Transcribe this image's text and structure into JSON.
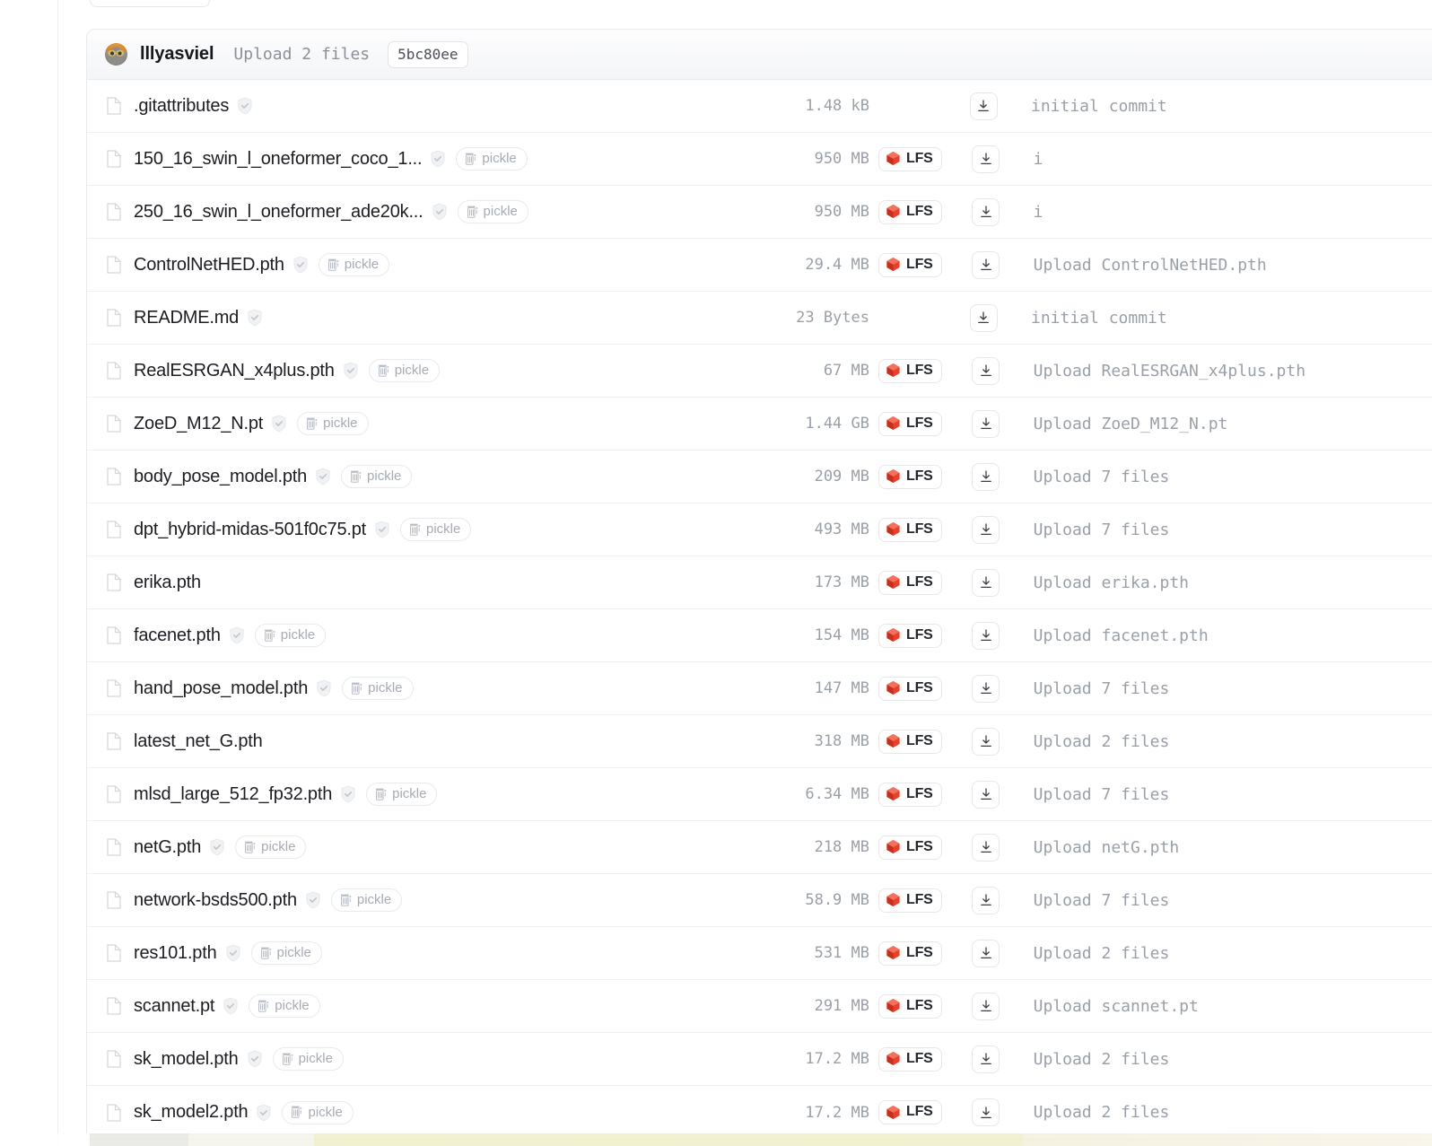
{
  "commit_header": {
    "author": "lllyasviel",
    "message": "Upload 2 files",
    "sha": "5bc80ee",
    "avatar_icon": "cat-avatar"
  },
  "badges": {
    "pickle_label": "pickle",
    "lfs_label": "LFS",
    "shield_icon": "shield-check-icon",
    "download_icon": "download-icon",
    "file_icon": "file-document-icon",
    "pickle_icon": "pickle-jar-icon",
    "lfs_icon": "lfs-cube-icon"
  },
  "colors": {
    "lfs_red": "#e8402a",
    "header_bg": "#f4f5f7",
    "border": "#e9eaec",
    "muted_text": "#9aa0a8",
    "name_text": "#1b1d22"
  },
  "files": [
    {
      "name": ".gitattributes",
      "shield": true,
      "pickle": false,
      "size": "1.48 kB",
      "lfs": false,
      "commit": "initial commit"
    },
    {
      "name": "150_16_swin_l_oneformer_coco_1...",
      "shield": true,
      "pickle": true,
      "size": "950 MB",
      "lfs": true,
      "commit": "i"
    },
    {
      "name": "250_16_swin_l_oneformer_ade20k...",
      "shield": true,
      "pickle": true,
      "size": "950 MB",
      "lfs": true,
      "commit": "i"
    },
    {
      "name": "ControlNetHED.pth",
      "shield": true,
      "pickle": true,
      "size": "29.4 MB",
      "lfs": true,
      "commit": "Upload ControlNetHED.pth"
    },
    {
      "name": "README.md",
      "shield": true,
      "pickle": false,
      "size": "23 Bytes",
      "lfs": false,
      "commit": "initial commit"
    },
    {
      "name": "RealESRGAN_x4plus.pth",
      "shield": true,
      "pickle": true,
      "size": "67 MB",
      "lfs": true,
      "commit": "Upload RealESRGAN_x4plus.pth"
    },
    {
      "name": "ZoeD_M12_N.pt",
      "shield": true,
      "pickle": true,
      "size": "1.44 GB",
      "lfs": true,
      "commit": "Upload ZoeD_M12_N.pt"
    },
    {
      "name": "body_pose_model.pth",
      "shield": true,
      "pickle": true,
      "size": "209 MB",
      "lfs": true,
      "commit": "Upload 7 files"
    },
    {
      "name": "dpt_hybrid-midas-501f0c75.pt",
      "shield": true,
      "pickle": true,
      "size": "493 MB",
      "lfs": true,
      "commit": "Upload 7 files"
    },
    {
      "name": "erika.pth",
      "shield": false,
      "pickle": false,
      "size": "173 MB",
      "lfs": true,
      "commit": "Upload erika.pth"
    },
    {
      "name": "facenet.pth",
      "shield": true,
      "pickle": true,
      "size": "154 MB",
      "lfs": true,
      "commit": "Upload facenet.pth"
    },
    {
      "name": "hand_pose_model.pth",
      "shield": true,
      "pickle": true,
      "size": "147 MB",
      "lfs": true,
      "commit": "Upload 7 files"
    },
    {
      "name": "latest_net_G.pth",
      "shield": false,
      "pickle": false,
      "size": "318 MB",
      "lfs": true,
      "commit": "Upload 2 files"
    },
    {
      "name": "mlsd_large_512_fp32.pth",
      "shield": true,
      "pickle": true,
      "size": "6.34 MB",
      "lfs": true,
      "commit": "Upload 7 files"
    },
    {
      "name": "netG.pth",
      "shield": true,
      "pickle": true,
      "size": "218 MB",
      "lfs": true,
      "commit": "Upload netG.pth"
    },
    {
      "name": "network-bsds500.pth",
      "shield": true,
      "pickle": true,
      "size": "58.9 MB",
      "lfs": true,
      "commit": "Upload 7 files"
    },
    {
      "name": "res101.pth",
      "shield": true,
      "pickle": true,
      "size": "531 MB",
      "lfs": true,
      "commit": "Upload 2 files"
    },
    {
      "name": "scannet.pt",
      "shield": true,
      "pickle": true,
      "size": "291 MB",
      "lfs": true,
      "commit": "Upload scannet.pt"
    },
    {
      "name": "sk_model.pth",
      "shield": true,
      "pickle": true,
      "size": "17.2 MB",
      "lfs": true,
      "commit": "Upload 2 files"
    },
    {
      "name": "sk_model2.pth",
      "shield": true,
      "pickle": true,
      "size": "17.2 MB",
      "lfs": true,
      "commit": "Upload 2 files"
    }
  ]
}
